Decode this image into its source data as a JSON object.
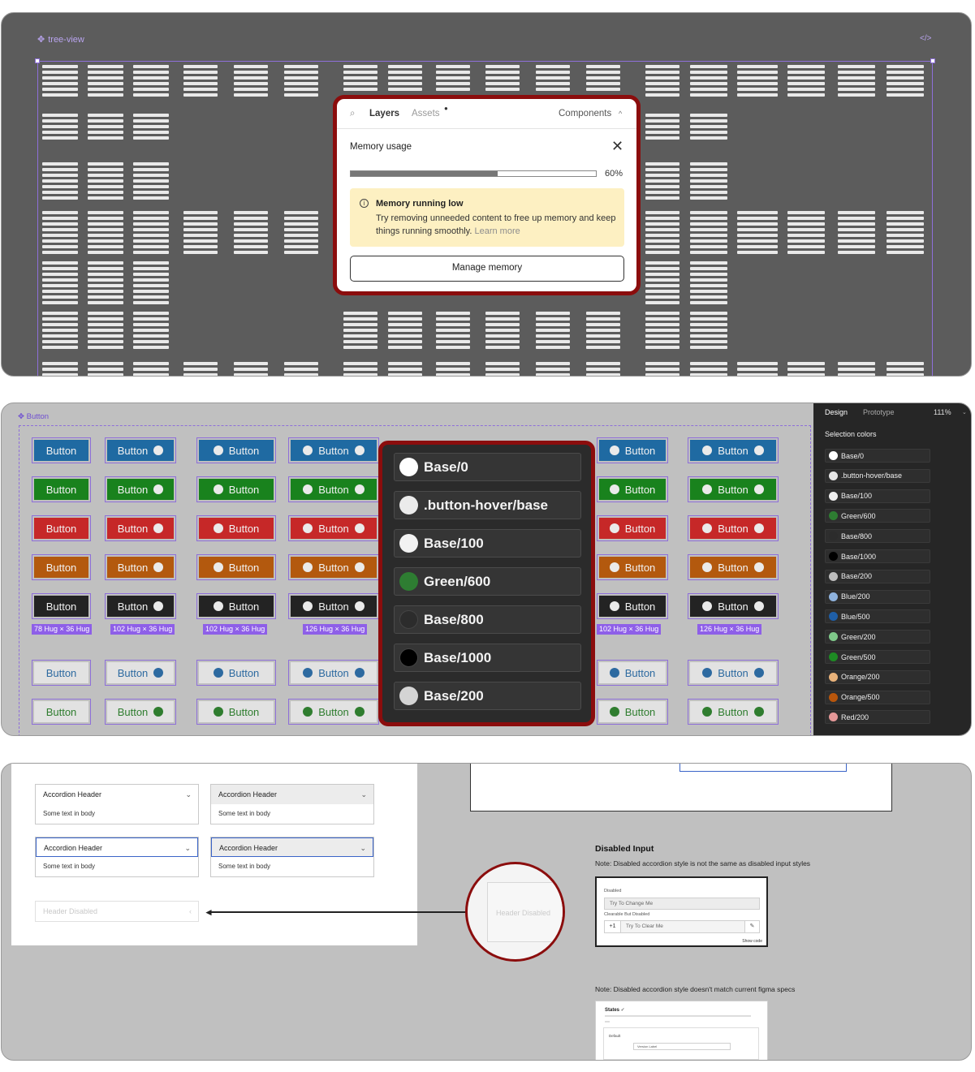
{
  "panel1": {
    "frame_label": "tree-view",
    "code_icon": "code-icon",
    "popup": {
      "tabs": {
        "layers": "Layers",
        "assets": "Assets",
        "components": "Components"
      },
      "memory_title": "Memory usage",
      "usage_fraction": 0.6,
      "usage_label": "60%",
      "warning": {
        "title": "Memory running low",
        "message": "Try removing unneeded content to free up memory and keep things running smoothly.",
        "link": "Learn more"
      },
      "manage_button": "Manage memory"
    }
  },
  "panel2": {
    "frame_label": "Button",
    "button_text": "Button",
    "row_colors": [
      "#1f6aa2",
      "#19821d",
      "#c62828",
      "#b3590e",
      "#232323"
    ],
    "outline_colors": [
      "#2d6aa0",
      "#2f7d2f"
    ],
    "hug_labels": [
      "78 Hug × 36 Hug",
      "102 Hug × 36 Hug",
      "102 Hug × 36 Hug",
      "126 Hug × 36 Hug",
      "102 Hug × 36 Hug",
      "126 Hug × 36 Hug"
    ],
    "dropdown": [
      {
        "name": "Base/0",
        "color": "#ffffff"
      },
      {
        "name": ".button-hover/base",
        "color": "#ebebeb"
      },
      {
        "name": "Base/100",
        "color": "#f2f2f2"
      },
      {
        "name": "Green/600",
        "color": "#2e7d32"
      },
      {
        "name": "Base/800",
        "color": "#2c2c2c"
      },
      {
        "name": "Base/1000",
        "color": "#000000"
      },
      {
        "name": "Base/200",
        "color": "#d4d4d4"
      }
    ],
    "sidebar": {
      "tab_design": "Design",
      "tab_prototype": "Prototype",
      "zoom": "111%",
      "section_title": "Selection colors",
      "colors": [
        {
          "name": "Base/0",
          "color": "#ffffff"
        },
        {
          "name": ".button-hover/base",
          "color": "#e6e6e6"
        },
        {
          "name": "Base/100",
          "color": "#eeeeee"
        },
        {
          "name": "Green/600",
          "color": "#2e7d32"
        },
        {
          "name": "Base/800",
          "color": "#2c2c2c"
        },
        {
          "name": "Base/1000",
          "color": "#000000"
        },
        {
          "name": "Base/200",
          "color": "#bdbdbd"
        },
        {
          "name": "Blue/200",
          "color": "#8fb3de"
        },
        {
          "name": "Blue/500",
          "color": "#1f5fa8"
        },
        {
          "name": "Green/200",
          "color": "#7fc98a"
        },
        {
          "name": "Green/500",
          "color": "#1e8b24"
        },
        {
          "name": "Orange/200",
          "color": "#e8b27a"
        },
        {
          "name": "Orange/500",
          "color": "#b8560c"
        },
        {
          "name": "Red/200",
          "color": "#e59898"
        }
      ]
    }
  },
  "panel3": {
    "accordion_header": "Accordion Header",
    "accordion_body": "Some text in body",
    "header_disabled": "Header Disabled",
    "disabled_input": {
      "title": "Disabled Input",
      "note": "Note: Disabled accordion style is not the same as disabled input styles",
      "label1": "Disabled",
      "field1": "Try To Change Me",
      "label2": "Clearable But Disabled",
      "plus": "+1",
      "field2": "Try To Clear Me",
      "clear": "✎",
      "show_code": "Show code"
    },
    "note2": "Note: Disabled accordion style doesn't match current figma specs",
    "states": {
      "title": "States ✓",
      "label": "Default",
      "field": "Version Label"
    }
  }
}
